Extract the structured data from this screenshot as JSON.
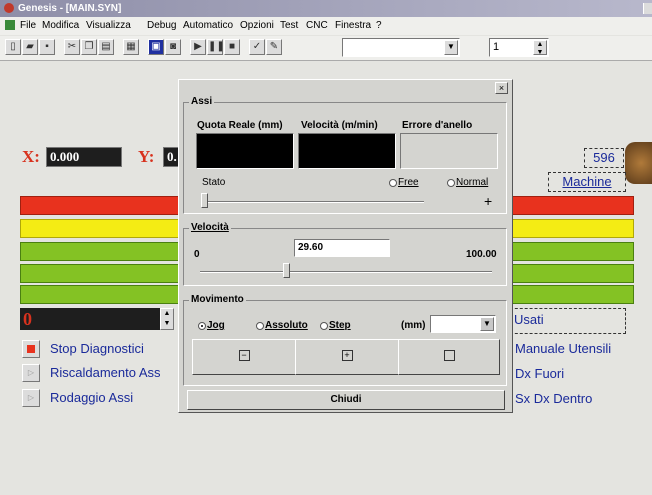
{
  "window": {
    "title": "Genesis - [MAIN.SYN]"
  },
  "menu": [
    "File",
    "Modifica",
    "Visualizza",
    "Debug",
    "Automatico",
    "Opzioni",
    "Test",
    "CNC",
    "Finestra",
    "?"
  ],
  "toolbar": {
    "spin_value": "1"
  },
  "coords": {
    "x_label": "X:",
    "x_value": "0.000",
    "y_label": "Y:",
    "y_value_partial": "0."
  },
  "machine": {
    "number": "596",
    "link": "Machine"
  },
  "counter": {
    "value": "0"
  },
  "left_buttons": [
    "Stop Diagnostici",
    "Riscaldamento Ass",
    "Rodaggio Assi"
  ],
  "right_texts": [
    "Usati",
    "Manuale Utensili",
    "Dx Fuori",
    "Sx Dx Dentro"
  ],
  "dialog": {
    "close_glyph": "×",
    "assi": {
      "group_label": "Assi",
      "col1": "Quota Reale (mm)",
      "col2": "Velocità (m/min)",
      "col3": "Errore d'anello",
      "stato_label": "Stato",
      "radio_free": "Free",
      "radio_normal": "Normal",
      "plus": "+",
      "slider_value": 0.0
    },
    "velocita": {
      "group_label": "Velocità",
      "min": "0",
      "max": "100.00",
      "value": "29.60",
      "slider_value": 0.296
    },
    "movimento": {
      "group_label": "Movimento",
      "radio_jog": "Jog",
      "radio_assoluto": "Assoluto",
      "radio_step": "Step",
      "unit": "(mm)"
    },
    "close_button": "Chiudi"
  },
  "colors": {
    "bar_red": "#e8321e",
    "bar_yellow": "#f4ec14",
    "bar_green": "#84c224",
    "accent_red": "#d8321e",
    "link_blue": "#1a2a9a"
  }
}
